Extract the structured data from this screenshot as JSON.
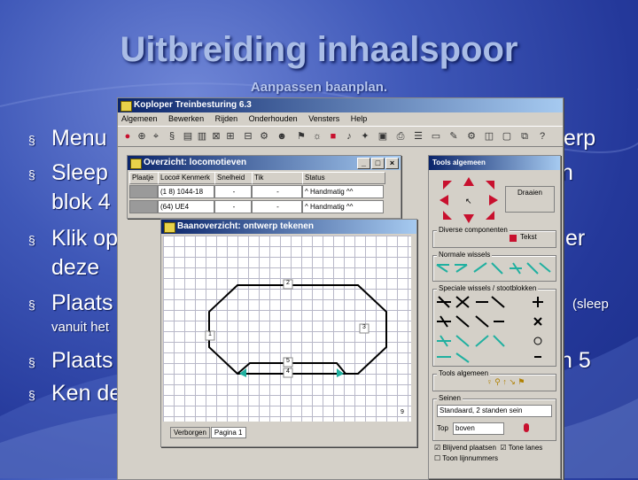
{
  "slide": {
    "title": "Uitbreiding inhaalspoor",
    "subtitle": "Aanpassen baanplan."
  },
  "bullets": [
    {
      "marker": "§",
      "text": "Menu",
      "tail": "erp"
    },
    {
      "marker": "§",
      "text": "Sleep",
      "tail": "n"
    },
    {
      "text": "blok 4"
    },
    {
      "marker": "§",
      "text": "Klik op",
      "tail": "er"
    },
    {
      "text": "deze"
    },
    {
      "marker": "§",
      "text": "Plaats",
      "tail": "(sleep"
    },
    {
      "text": "vanuit het"
    },
    {
      "marker": "§",
      "text": "Plaats",
      "tail": "n 5"
    },
    {
      "marker": "§",
      "text": "Ken de"
    }
  ],
  "main_window": {
    "title": "Koploper Treinbesturing 6.3",
    "menu": [
      "Algemeen",
      "Bewerken",
      "Rijden",
      "Onderhouden",
      "Vensters",
      "Help"
    ]
  },
  "loco_window": {
    "title": "Overzicht: locomotieven",
    "columns": [
      "Plaatje",
      "Loco# Kenmerk",
      "Snelheid",
      "Tik",
      "Status"
    ],
    "rows": [
      {
        "id": "(1 8) 1044-18",
        "speed": "-",
        "tik": "-",
        "status": "^ Handmatig ^^"
      },
      {
        "id": "(64) UE4",
        "speed": "-",
        "tik": "-",
        "status": "^ Handmatig ^^"
      }
    ]
  },
  "design_window": {
    "title": "Baanoverzicht: ontwerp tekenen",
    "block_labels": [
      "2",
      "1",
      "3",
      "5",
      "4",
      "9"
    ],
    "tabs": [
      "Verborgen",
      "Pagina 1"
    ]
  },
  "toolbox": {
    "title": "Tools algemeen",
    "draaien": "Draaien",
    "groups": [
      "Diverse componenten",
      "Normale wissels",
      "Speciale wissels / stootblokken",
      "Tools algemeen",
      "Seinen"
    ],
    "tekst": "Tekst",
    "seinen_select": "Standaard, 2 standen sein",
    "top_label": "Top",
    "top_value": "boven",
    "checkboxes": [
      "Blijvend plaatsen",
      "Tone lanes",
      "Toon lijnnummers"
    ]
  },
  "colors": {
    "accent_red": "#c8102e",
    "grid_green": "#20b0a0"
  }
}
